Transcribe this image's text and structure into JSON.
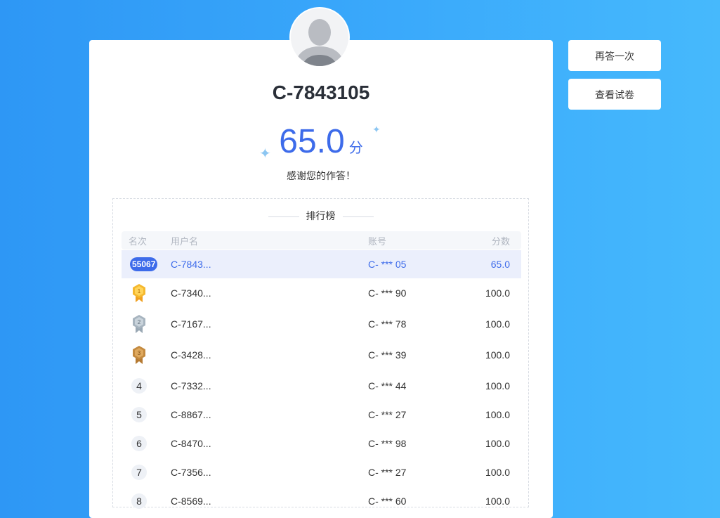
{
  "user": {
    "name": "C-7843105"
  },
  "score": {
    "value": "65.0",
    "unit": "分",
    "message": "感谢您的作答！"
  },
  "actions": {
    "retry_label": "再答一次",
    "view_paper_label": "查看试卷"
  },
  "leaderboard": {
    "title": "排行榜",
    "columns": {
      "rank": "名次",
      "user": "用户名",
      "account": "账号",
      "score": "分数"
    },
    "current": {
      "rank": "55067",
      "user": "C-7843...",
      "account": "C- *** 05",
      "score": "65.0"
    },
    "rows": [
      {
        "rank": "1",
        "medal": "gold",
        "user": "C-7340...",
        "account": "C- *** 90",
        "score": "100.0"
      },
      {
        "rank": "2",
        "medal": "silver",
        "user": "C-7167...",
        "account": "C- *** 78",
        "score": "100.0"
      },
      {
        "rank": "3",
        "medal": "bronze",
        "user": "C-3428...",
        "account": "C- *** 39",
        "score": "100.0"
      },
      {
        "rank": "4",
        "user": "C-7332...",
        "account": "C- *** 44",
        "score": "100.0"
      },
      {
        "rank": "5",
        "user": "C-8867...",
        "account": "C- *** 27",
        "score": "100.0"
      },
      {
        "rank": "6",
        "user": "C-8470...",
        "account": "C- *** 98",
        "score": "100.0"
      },
      {
        "rank": "7",
        "user": "C-7356...",
        "account": "C- *** 27",
        "score": "100.0"
      },
      {
        "rank": "8",
        "user": "C-8569...",
        "account": "C- *** 60",
        "score": "100.0"
      }
    ]
  },
  "colors": {
    "accent": "#3d6bea",
    "gold": "#f5a623",
    "silver": "#a7b4bf",
    "bronze": "#c48a3f",
    "background": "#2e97f5"
  }
}
